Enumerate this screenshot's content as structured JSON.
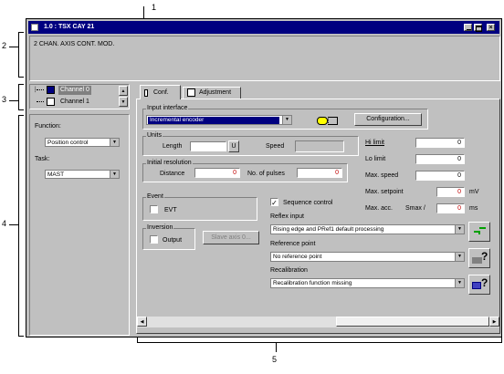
{
  "callouts": {
    "c1": "1",
    "c2": "2",
    "c3": "3",
    "c4": "4",
    "c5": "5"
  },
  "window": {
    "title": "1.0 : TSX CAY 21"
  },
  "module": {
    "description": "2 CHAN. AXIS CONT. MOD."
  },
  "channels": [
    "Channel 0",
    "Channel 1"
  ],
  "left": {
    "function_label": "Function:",
    "function_value": "Position control",
    "task_label": "Task:",
    "task_value": "MAST"
  },
  "tabs": {
    "conf": "Conf.",
    "adjustment": "Adjustment"
  },
  "input_interface": {
    "label": "Input interface",
    "value": "Incremental encoder",
    "config_button": "Configuration..."
  },
  "units": {
    "label": "Units",
    "length_label": "Length",
    "length_unit": "U",
    "speed_label": "Speed"
  },
  "resolution": {
    "label": "Initial resolution",
    "distance_label": "Distance",
    "distance_value": "0",
    "pulses_label": "No. of pulses",
    "pulses_value": "0"
  },
  "limits": {
    "hi_label": "Hi limit",
    "hi_value": "0",
    "lo_label": "Lo limit",
    "lo_value": "0",
    "max_speed_label": "Max. speed",
    "max_speed_value": "0",
    "max_setpoint_label": "Max. setpoint",
    "max_setpoint_value": "0",
    "max_setpoint_unit": "mV",
    "max_acc_label": "Max. acc.",
    "smax_label": "Smax /",
    "max_acc_value": "0",
    "max_acc_unit": "ms"
  },
  "event": {
    "label": "Event",
    "evt_label": "EVT"
  },
  "sequence": {
    "label": "Sequence control",
    "checked": "✓"
  },
  "inversion": {
    "label": "Inversion",
    "output_label": "Output",
    "slave_button": "Slave axis 0..."
  },
  "reflex": {
    "label": "Reflex input",
    "value": "Rising edge and PRef1 default processing"
  },
  "reference": {
    "label": "Reference point",
    "value": "No reference point"
  },
  "recalibration": {
    "label": "Recalibration",
    "value": "Recalibration function missing"
  },
  "colors": {
    "title_bar": "#000080",
    "face": "#c0c0c0",
    "red_value": "#c00000"
  }
}
